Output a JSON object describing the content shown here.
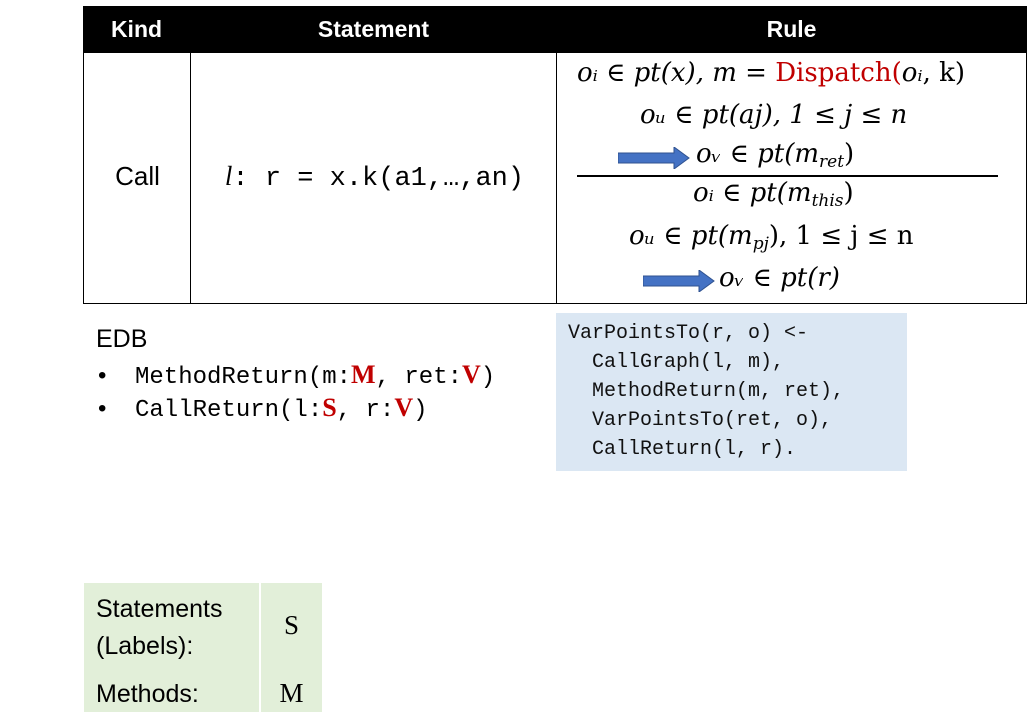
{
  "table": {
    "headers": {
      "kind": "Kind",
      "statement": "Statement",
      "rule": "Rule"
    },
    "row": {
      "kind": "Call",
      "statement_label": "l",
      "statement_code": ": r = x.k(a1,…,an)"
    },
    "rule": {
      "premise1_a": "oᵢ ∈ pt(x),  m = ",
      "premise1_dispatch": "Dispatch(",
      "premise1_oi": "oᵢ",
      "premise1_tail": ", k)",
      "premise2": "oᵤ ∈ pt(aj), 1 ≤ j ≤ n",
      "premise3_a": "oᵥ ∈ pt(m",
      "premise3_sub": "ret",
      "premise3_b": ")",
      "concl1_a": "oᵢ ∈ pt(m",
      "concl1_sub": "this",
      "concl1_b": ")",
      "concl2_a": "oᵤ ∈ pt(m",
      "concl2_sub": "pj",
      "concl2_b": "), 1 ≤ j ≤ n",
      "concl3": "oᵥ ∈ pt(r)"
    },
    "arrow_color": "#4472c4"
  },
  "edb": {
    "title": "EDB",
    "items": [
      {
        "bullet": "•",
        "pre": "MethodReturn(m:",
        "t1": "M",
        "mid": ", ret:",
        "t2": "V",
        "post": ")"
      },
      {
        "bullet": "•",
        "pre": "CallReturn(l:",
        "t1": "S",
        "mid": ", r:",
        "t2": "V",
        "post": ")"
      }
    ]
  },
  "code_box": {
    "lines": [
      "VarPointsTo(r, o) <-",
      "  CallGraph(l, m),",
      "  MethodReturn(m, ret),",
      "  VarPointsTo(ret, o),",
      "  CallReturn(l, r)."
    ]
  },
  "domains": {
    "statements_label_1": "Statements",
    "statements_label_2": "(Labels):",
    "statements_value": "S",
    "methods_label": "Methods:",
    "methods_value": "M"
  },
  "colors": {
    "accent_red": "#c00000",
    "code_bg": "#dbe7f3",
    "domains_bg": "#e2efd9"
  }
}
